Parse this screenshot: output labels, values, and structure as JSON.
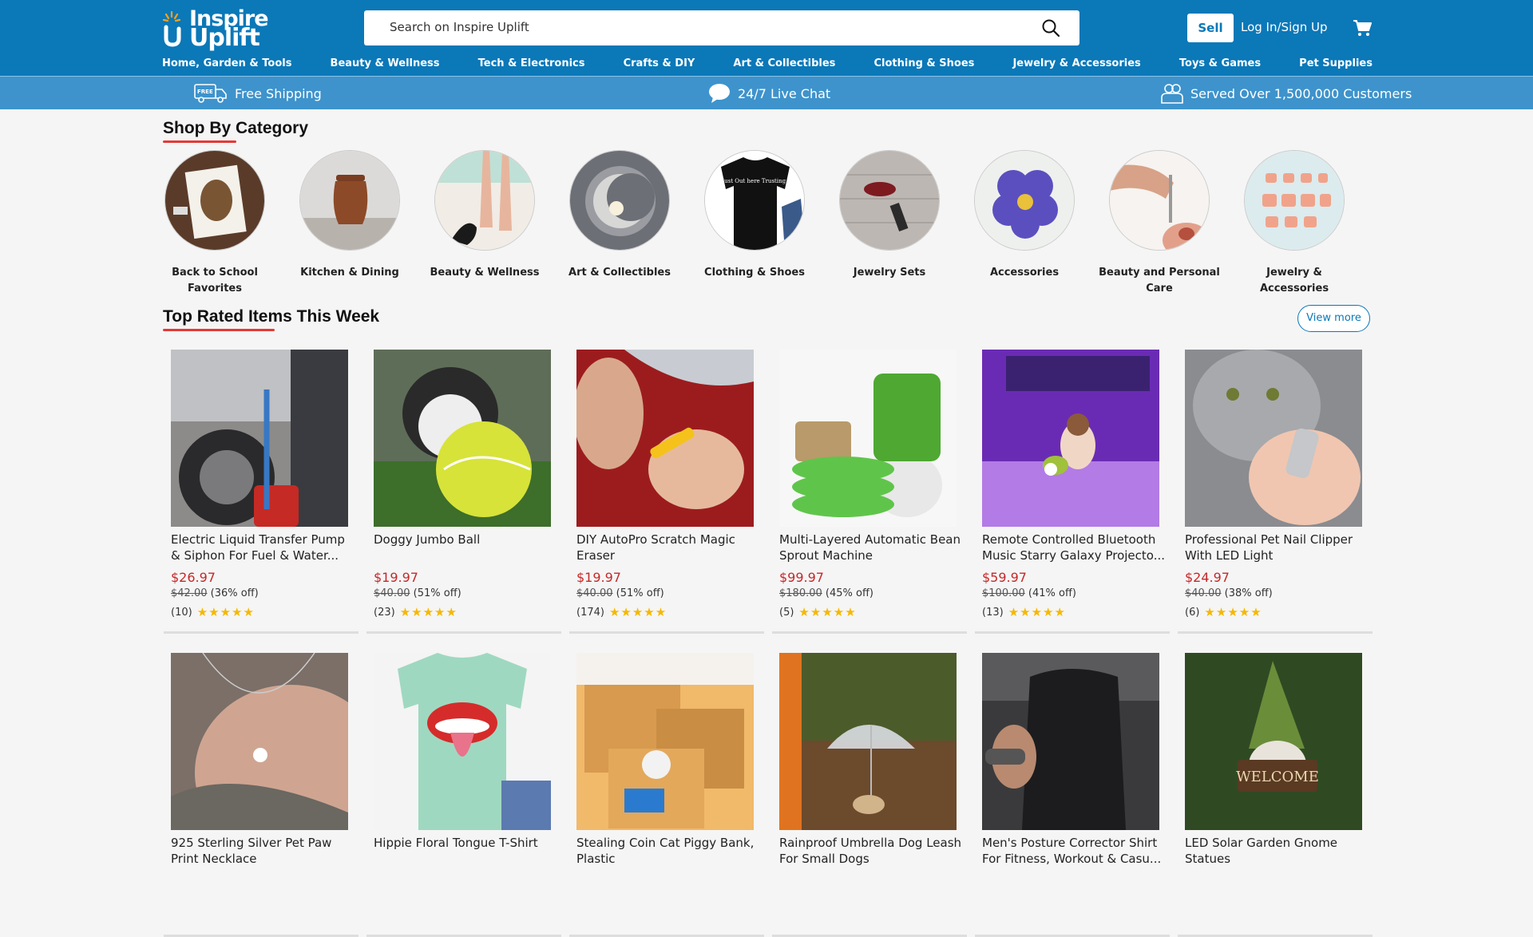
{
  "header": {
    "logo_line1": "Inspire",
    "logo_line2": "Uplift",
    "search_placeholder": "Search on Inspire Uplift",
    "sell_label": "Sell",
    "login_label": "Log In/Sign Up",
    "cart_icon": "cart-icon",
    "brand_color": "#0b78b8"
  },
  "nav": [
    "Home, Garden & Tools",
    "Beauty & Wellness",
    "Tech & Electronics",
    "Crafts & DIY",
    "Art & Collectibles",
    "Clothing & Shoes",
    "Jewelry & Accessories",
    "Toys & Games",
    "Pet Supplies"
  ],
  "infobar": {
    "free_shipping": "Free Shipping",
    "free_badge": "FREE",
    "live_chat": "24/7 Live Chat",
    "customers": "Served Over 1,500,000 Customers"
  },
  "categories_title": "Shop By Category",
  "categories": [
    {
      "label": "Back to School Favorites"
    },
    {
      "label": "Kitchen & Dining"
    },
    {
      "label": "Beauty & Wellness"
    },
    {
      "label": "Art & Collectibles"
    },
    {
      "label": "Clothing & Shoes"
    },
    {
      "label": "Jewelry Sets"
    },
    {
      "label": "Accessories"
    },
    {
      "label": "Beauty and Personal Care"
    },
    {
      "label": "Jewelry & Accessories"
    }
  ],
  "tshirt_text": "I'm just Out here Trusting God",
  "top_rated_title": "Top Rated Items This Week",
  "view_more": "View more",
  "products": [
    {
      "title": "Electric Liquid Transfer Pump & Siphon For Fuel & Water...",
      "price": "$26.97",
      "old_price": "$42.00",
      "discount": "(36% off)",
      "reviews": "(10)",
      "stars": "★★★★★"
    },
    {
      "title": "Doggy Jumbo Ball",
      "price": "$19.97",
      "old_price": "$40.00",
      "discount": "(51% off)",
      "reviews": "(23)",
      "stars": "★★★★★"
    },
    {
      "title": "DIY AutoPro Scratch Magic Eraser",
      "price": "$19.97",
      "old_price": "$40.00",
      "discount": "(51% off)",
      "reviews": "(174)",
      "stars": "★★★★★"
    },
    {
      "title": "Multi-Layered Automatic Bean Sprout Machine",
      "price": "$99.97",
      "old_price": "$180.00",
      "discount": "(45% off)",
      "reviews": "(5)",
      "stars": "★★★★★"
    },
    {
      "title": "Remote Controlled Bluetooth Music Starry Galaxy Projecto...",
      "price": "$59.97",
      "old_price": "$100.00",
      "discount": "(41% off)",
      "reviews": "(13)",
      "stars": "★★★★★"
    },
    {
      "title": "Professional Pet Nail Clipper With LED Light",
      "price": "$24.97",
      "old_price": "$40.00",
      "discount": "(38% off)",
      "reviews": "(6)",
      "stars": "★★★★★"
    },
    {
      "title": "925 Sterling Silver Pet Paw Print Necklace"
    },
    {
      "title": "Hippie Floral Tongue T-Shirt"
    },
    {
      "title": "Stealing Coin Cat Piggy Bank, Plastic"
    },
    {
      "title": "Rainproof Umbrella Dog Leash For Small Dogs"
    },
    {
      "title": "Men's Posture Corrector Shirt For Fitness, Workout & Casu..."
    },
    {
      "title": "LED Solar Garden Gnome Statues"
    }
  ],
  "welcome_sign": "WELCOME"
}
